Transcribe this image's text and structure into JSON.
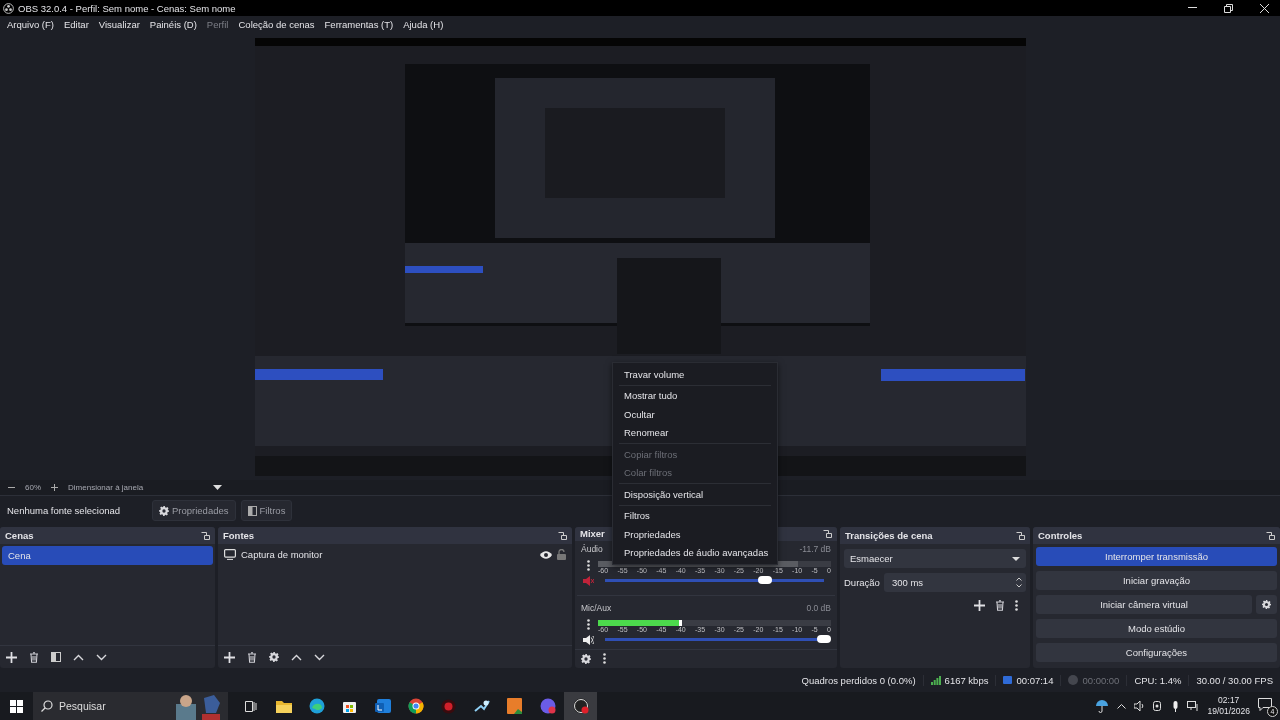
{
  "window": {
    "title": "OBS 32.0.4 - Perfil: Sem nome - Cenas: Sem nome"
  },
  "menu_bar": [
    {
      "label": "Arquivo (F)",
      "disabled": false
    },
    {
      "label": "Editar",
      "disabled": false
    },
    {
      "label": "Visualizar",
      "disabled": false
    },
    {
      "label": "Painéis (D)",
      "disabled": false
    },
    {
      "label": "Perfil",
      "disabled": true
    },
    {
      "label": "Coleção de cenas",
      "disabled": false
    },
    {
      "label": "Ferramentas (T)",
      "disabled": false
    },
    {
      "label": "Ajuda (H)",
      "disabled": false
    }
  ],
  "zoom_bar": {
    "zoom": "60%",
    "fit": "Dimensionar à janela"
  },
  "context_bar": {
    "source": "Nenhuma fonte selecionad",
    "buttons": [
      {
        "label": "Propriedades"
      },
      {
        "label": "Filtros"
      }
    ]
  },
  "scenes": {
    "title": "Cenas",
    "items": [
      {
        "label": "Cena",
        "selected": true
      }
    ]
  },
  "sources": {
    "title": "Fontes",
    "items": [
      {
        "label": "Captura de monitor",
        "visible": true,
        "locked": false
      }
    ]
  },
  "mixer": {
    "title": "Mixer",
    "channels": [
      {
        "name": "Áudio",
        "reading": "-11.7 dB",
        "muted": true,
        "meter": {
          "level": 0.86
        },
        "fader": {
          "level": 0.73
        },
        "scale": [
          "-60",
          "-55",
          "-50",
          "-45",
          "-40",
          "-35",
          "-30",
          "-25",
          "-20",
          "-15",
          "-10",
          "-5",
          "0"
        ]
      },
      {
        "name": "Mic/Aux",
        "reading": "0.0 dB",
        "muted": false,
        "meter": {
          "level": 0.36
        },
        "fader": {
          "level": 1
        },
        "scale": [
          "-60",
          "-55",
          "-50",
          "-45",
          "-40",
          "-35",
          "-30",
          "-25",
          "-20",
          "-15",
          "-10",
          "-5",
          "0"
        ]
      }
    ]
  },
  "transitions": {
    "title": "Transições de cena",
    "transition": "Esmaecer",
    "duration_label": "Duração",
    "duration": "300 ms"
  },
  "controls": {
    "title": "Controles",
    "buttons": [
      {
        "label": "Interromper transmissão",
        "active": true,
        "settings": false
      },
      {
        "label": "Iniciar gravação",
        "active": false,
        "settings": false
      },
      {
        "label": "Iniciar câmera virtual",
        "active": false,
        "settings": true
      },
      {
        "label": "Modo estúdio",
        "active": false,
        "settings": false
      },
      {
        "label": "Configurações",
        "active": false,
        "settings": false
      }
    ]
  },
  "context_menu": {
    "items": [
      {
        "kind": "item",
        "label": "Travar volume",
        "disabled": false
      },
      {
        "kind": "separator"
      },
      {
        "kind": "item",
        "label": "Mostrar tudo",
        "disabled": false
      },
      {
        "kind": "item",
        "label": "Ocultar",
        "disabled": false
      },
      {
        "kind": "item",
        "label": "Renomear",
        "disabled": false
      },
      {
        "kind": "separator"
      },
      {
        "kind": "item",
        "label": "Copiar filtros",
        "disabled": true
      },
      {
        "kind": "item",
        "label": "Colar filtros",
        "disabled": true
      },
      {
        "kind": "separator"
      },
      {
        "kind": "item",
        "label": "Disposição vertical",
        "disabled": false
      },
      {
        "kind": "separator"
      },
      {
        "kind": "item",
        "label": "Filtros",
        "disabled": false
      },
      {
        "kind": "item",
        "label": "Propriedades",
        "disabled": false
      },
      {
        "kind": "item",
        "label": "Propriedades de áudio avançadas",
        "disabled": false
      }
    ]
  },
  "status_bar": {
    "dropped": "Quadros perdidos 0 (0.0%)",
    "bitrate": "6167 kbps",
    "stream_time": "00:07:14",
    "streaming": true,
    "record_time": "00:00:00",
    "recording": false,
    "cpu": "CPU: 1.4%",
    "fps": "30.00 / 30.00 FPS"
  },
  "taskbar": {
    "search": {
      "placeholder": "Pesquisar"
    },
    "apps": [
      {
        "kind": "taskview",
        "active": false
      },
      {
        "kind": "folder",
        "active": false
      },
      {
        "kind": "swirl",
        "active": false
      },
      {
        "kind": "bag",
        "active": false
      },
      {
        "kind": "mail",
        "active": false
      },
      {
        "kind": "ring",
        "active": false
      },
      {
        "kind": "redbadge",
        "active": false
      },
      {
        "kind": "steam",
        "active": false
      },
      {
        "kind": "orange",
        "active": false
      },
      {
        "kind": "chat",
        "active": false
      },
      {
        "kind": "obs",
        "active": true
      }
    ],
    "time": "02:17",
    "date": "19/01/2026",
    "notifications": "4"
  }
}
